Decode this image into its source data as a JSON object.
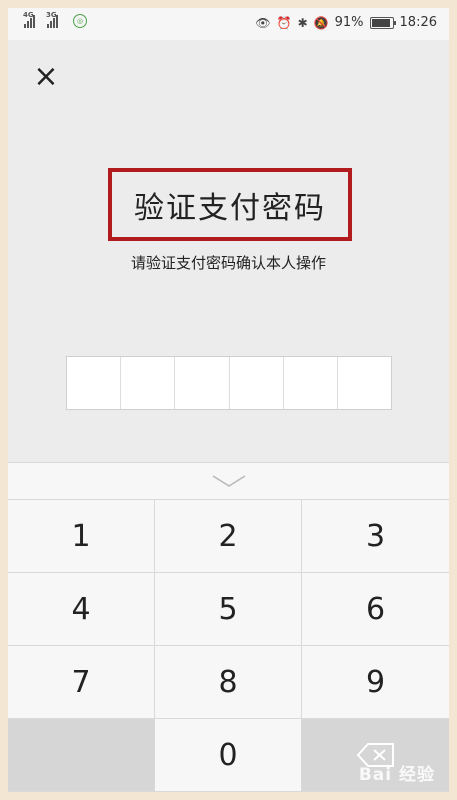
{
  "status_bar": {
    "signal_1_label": "4G",
    "signal_2_label": "3G",
    "battery_percent": "91%",
    "battery_level": 0.91,
    "time": "18:26",
    "icons": [
      "eye-icon",
      "alarm-icon",
      "bluetooth-icon",
      "mute-icon",
      "battery-icon"
    ]
  },
  "dialog": {
    "close_glyph": "×",
    "title": "验证支付密码",
    "subtitle": "请验证支付密码确认本人操作",
    "pin_length": 6
  },
  "keypad": {
    "keys": [
      "1",
      "2",
      "3",
      "4",
      "5",
      "6",
      "7",
      "8",
      "9"
    ],
    "zero": "0",
    "delete_icon": "backspace-icon",
    "collapse_icon": "chevron-down-icon"
  },
  "watermark": "Bai 经验"
}
